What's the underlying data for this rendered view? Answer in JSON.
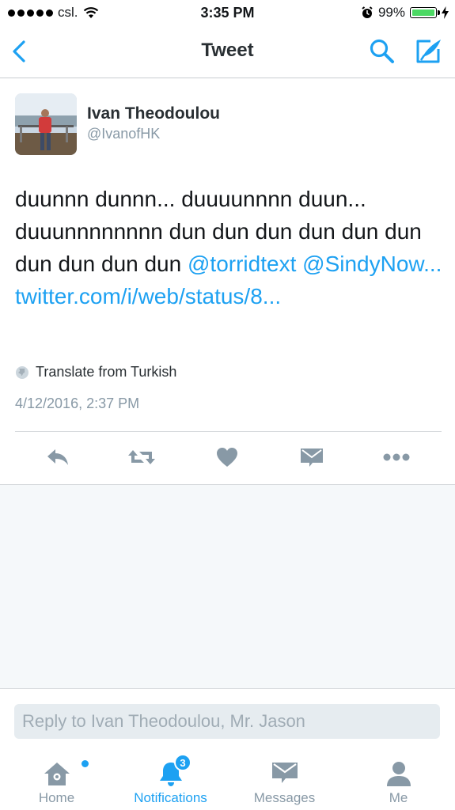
{
  "status_bar": {
    "carrier": "csl.",
    "time": "3:35 PM",
    "battery_percent": "99%"
  },
  "nav": {
    "title": "Tweet"
  },
  "tweet": {
    "author_name": "Ivan Theodoulou",
    "author_handle": "@IvanofHK",
    "text_plain": "duunnn dunnn... duuuunnnn duun... duuunnnnnnnn dun dun dun dun dun dun dun dun dun dun",
    "mention_1": "@torridtext",
    "mention_2": "@SindyNow...",
    "link": "twitter.com/i/web/status/8...",
    "translate_label": "Translate from Turkish",
    "timestamp": "4/12/2016, 2:37 PM"
  },
  "actions": [
    "reply-icon",
    "retweet-icon",
    "like-icon",
    "direct-message-icon",
    "more-icon"
  ],
  "reply": {
    "placeholder": "Reply to Ivan Theodoulou, Mr. Jason"
  },
  "tabs": {
    "home": "Home",
    "notifications": "Notifications",
    "notifications_badge": "3",
    "messages": "Messages",
    "me": "Me"
  },
  "colors": {
    "accent": "#1da1f2",
    "muted": "#8899a6",
    "icon_gray": "#8899a6",
    "background_empty": "#f5f8fa",
    "battery": "#4cd964"
  }
}
